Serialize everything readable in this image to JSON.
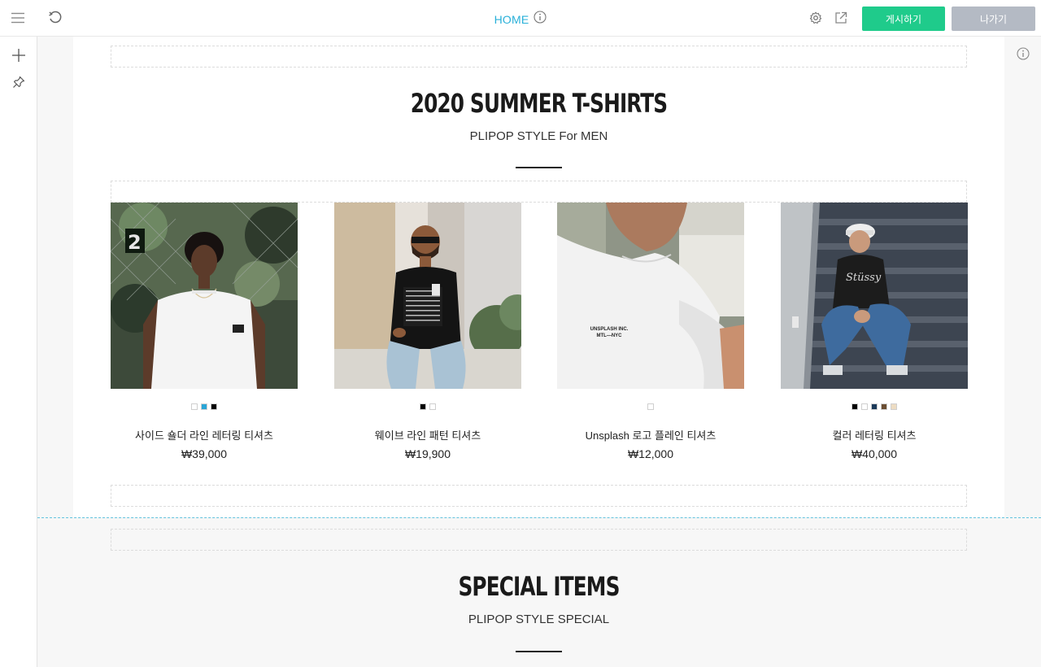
{
  "header": {
    "page_title": "HOME",
    "publish_label": "게시하기",
    "exit_label": "나가기"
  },
  "icons": {
    "menu": "menu-icon",
    "undo": "undo-icon",
    "info": "info-icon",
    "settings": "gear-icon",
    "external": "external-link-icon",
    "add": "plus-icon",
    "pin": "pin-icon"
  },
  "colors": {
    "accent": "#29b0d9",
    "publish": "#1fcb8b",
    "exit": "#b4bac4"
  },
  "section1": {
    "title": "2020 SUMMER T-SHIRTS",
    "subtitle": "PLIPOP STYLE For MEN",
    "products": [
      {
        "name": "사이드 숄더 라인 레터링 티셔츠",
        "price": "₩39,000",
        "swatches": [
          "#ffffff",
          "#2aa5d6",
          "#000000"
        ]
      },
      {
        "name": "웨이브 라인 패턴 티셔츠",
        "price": "₩19,900",
        "swatches": [
          "#000000",
          "#ffffff"
        ]
      },
      {
        "name": "Unsplash 로고 플레인 티셔츠",
        "price": "₩12,000",
        "swatches": [
          "#ffffff"
        ],
        "image_text": [
          "UNSPLASH INC.",
          "MTL—NYC"
        ]
      },
      {
        "name": "컬러 레터링 티셔츠",
        "price": "₩40,000",
        "swatches": [
          "#000000",
          "#ffffff",
          "#1c3a5a",
          "#6a4e32",
          "#eddcc3"
        ]
      }
    ]
  },
  "section2": {
    "title": "SPECIAL ITEMS",
    "subtitle": "PLIPOP STYLE SPECIAL"
  }
}
